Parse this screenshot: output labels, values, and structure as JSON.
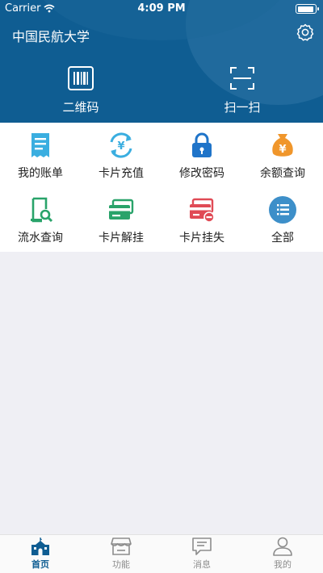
{
  "status_bar": {
    "carrier": "Carrier",
    "time": "4:09 PM"
  },
  "header": {
    "title": "中国民航大学"
  },
  "hero": {
    "qrcode_label": "二维码",
    "scan_label": "扫一扫"
  },
  "functions": [
    {
      "label": "我的账单",
      "icon": "bill-icon"
    },
    {
      "label": "卡片充值",
      "icon": "recharge-icon"
    },
    {
      "label": "修改密码",
      "icon": "lock-icon"
    },
    {
      "label": "余额查询",
      "icon": "money-bag-icon"
    },
    {
      "label": "流水查询",
      "icon": "search-document-icon"
    },
    {
      "label": "卡片解挂",
      "icon": "card-unlock-icon"
    },
    {
      "label": "卡片挂失",
      "icon": "card-lost-icon"
    },
    {
      "label": "全部",
      "icon": "all-menu-icon"
    }
  ],
  "tabbar": {
    "items": [
      {
        "label": "首页",
        "icon": "home-icon",
        "active": true
      },
      {
        "label": "功能",
        "icon": "shop-icon",
        "active": false
      },
      {
        "label": "消息",
        "icon": "message-icon",
        "active": false
      },
      {
        "label": "我的",
        "icon": "user-icon",
        "active": false
      }
    ]
  },
  "colors": {
    "header_blue": "#0f5d92",
    "bill": "#3aaee0",
    "recharge": "#3aaee0",
    "lock": "#1f74c9",
    "money_bag": "#f0962b",
    "search_doc": "#29a36a",
    "card_unlock": "#29a36a",
    "card_lost": "#e04a55",
    "all_menu": "#3d8fc9"
  }
}
